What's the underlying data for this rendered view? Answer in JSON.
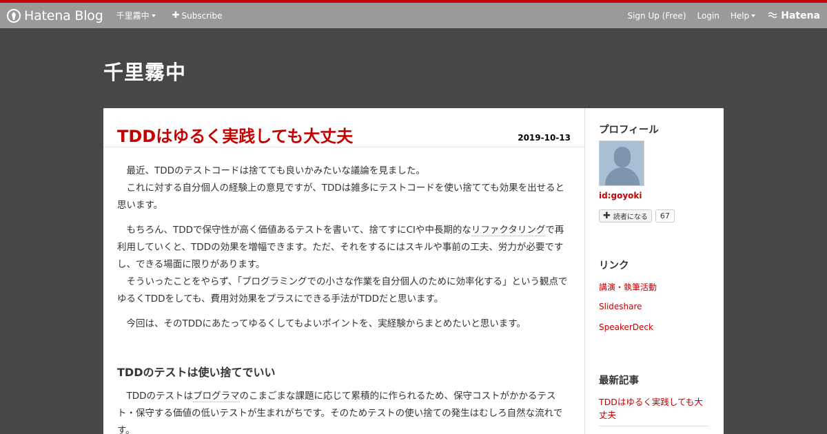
{
  "globalnav": {
    "brand": "Hatena Blog",
    "blog_menu": "千里霧中",
    "subscribe": "Subscribe",
    "signup": "Sign Up (Free)",
    "login": "Login",
    "help": "Help",
    "hatena": "Hatena"
  },
  "blog": {
    "title": "千里霧中"
  },
  "entry": {
    "title": "TDDはゆるく実践しても大丈夫",
    "date": "2019-10-13",
    "p1_line1": "最近、TDDのテストコードは捨てても良いかみたいな議論を見ました。",
    "p1_line2": "これに対する自分個人の経験上の意見ですが、TDDは雑多にテストコードを使い捨てても効果を出せると思います。",
    "p2_pre": "もちろん、TDDで保守性が高く価値あるテストを書いて、捨てすにCIや中長期的な",
    "p2_kw": "リファクタリング",
    "p2_post": "で再利用していくと、TDDの効果を増幅できます。ただ、それをするにはスキルや事前の工夫、労力が必要ですし、できる場面に限りがあります。",
    "p2_line2": "そういったことをやらず、「プログラミングでの小さな作業を自分個人のために効率化する」という観点でゆるくTDDをしても、費用対効果をプラスにできる手法がTDDだと思います。",
    "p3": "今回は、そのTDDにあたってゆるくしてもよいポイントを、実経験からまとめたいと思います。",
    "h3": "TDDのテストは使い捨てでいい",
    "p4_pre": "TDDのテストは",
    "p4_kw": "プログラマ",
    "p4_post": "のこまごまな課題に応じて累積的に作られるため、保守コストがかかるテスト・保守する価値の低いテストが生まれがちです。そのためテストの使い捨ての発生はむしろ自然な流れです。"
  },
  "sidebar": {
    "profile_title": "プロフィール",
    "profile_id": "id:goyoki",
    "subscribe_label": "読者になる",
    "subscriber_count": "67",
    "links_title": "リンク",
    "links": [
      "講演・執筆活動",
      "Slideshare",
      "SpeakerDeck"
    ],
    "recent_title": "最新記事",
    "recent": [
      "TDDはゆるく実践しても大丈夫"
    ]
  },
  "colors": {
    "accent": "#c40000",
    "nav_bg": "#9a9a9a",
    "page_bg": "#474747"
  }
}
